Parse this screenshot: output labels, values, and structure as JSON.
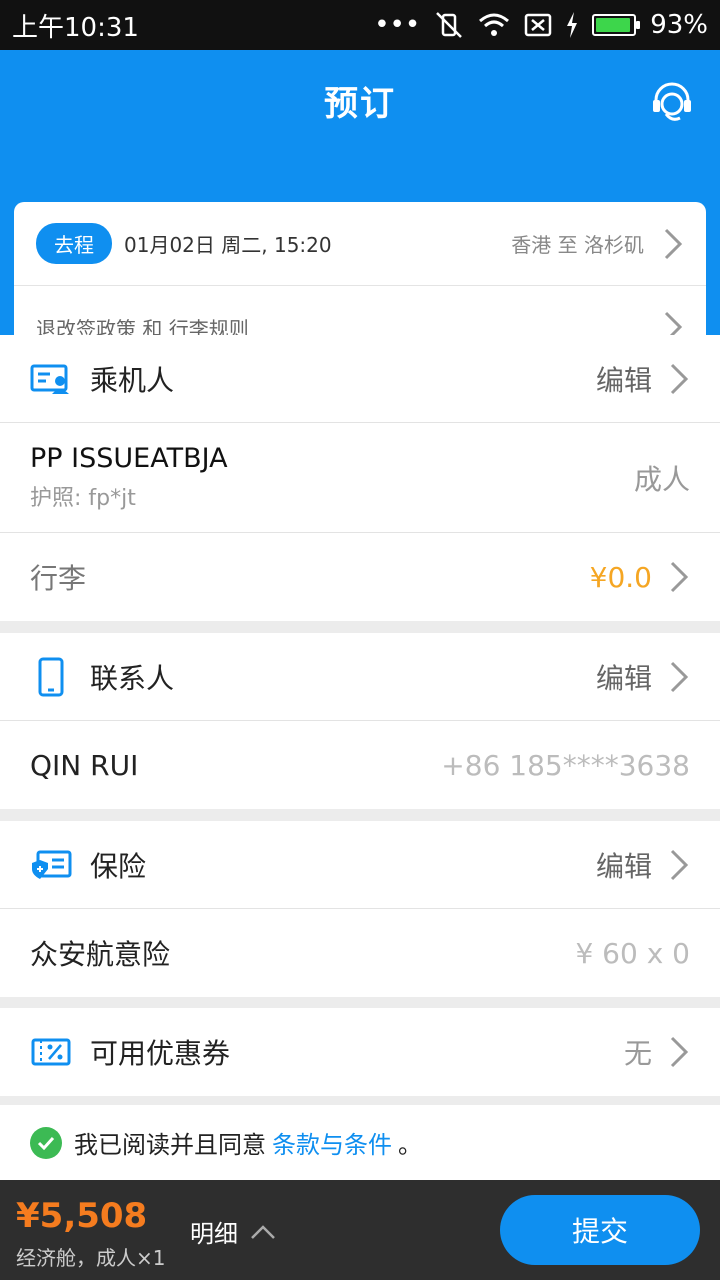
{
  "status_bar": {
    "time": "上午10:31",
    "battery": "93%",
    "battery_level": 0.93
  },
  "header": {
    "title": "预订"
  },
  "trip": {
    "tag": "去程",
    "date": "01月02日 周二, 15:20",
    "route": "香港 至 洛杉矶",
    "policy": "退改签政策 和 行李规则"
  },
  "passengers": {
    "title": "乘机人",
    "edit": "编辑",
    "name": "PP ISSUEATBJA",
    "passport": "护照: fp*jt",
    "type": "成人",
    "baggage_label": "行李",
    "baggage_price": "¥0.0"
  },
  "contact": {
    "title": "联系人",
    "edit": "编辑",
    "name": "QIN RUI",
    "phone": "+86 185****3638"
  },
  "insurance": {
    "title": "保险",
    "edit": "编辑",
    "item": "众安航意险",
    "price": "¥ 60 x 0"
  },
  "coupon": {
    "title": "可用优惠券",
    "value": "无"
  },
  "agreement": {
    "prefix": "我已阅读并且同意",
    "link": "条款与条件",
    "suffix": "。"
  },
  "bottom": {
    "price": "¥5,508",
    "class_info": "经济舱，成人×1",
    "detail": "明细",
    "submit": "提交"
  },
  "colors": {
    "primary": "#0f8ff0",
    "price_orange": "#f57c1f",
    "baggage_orange": "#f5a623",
    "check_green": "#3cba54"
  }
}
